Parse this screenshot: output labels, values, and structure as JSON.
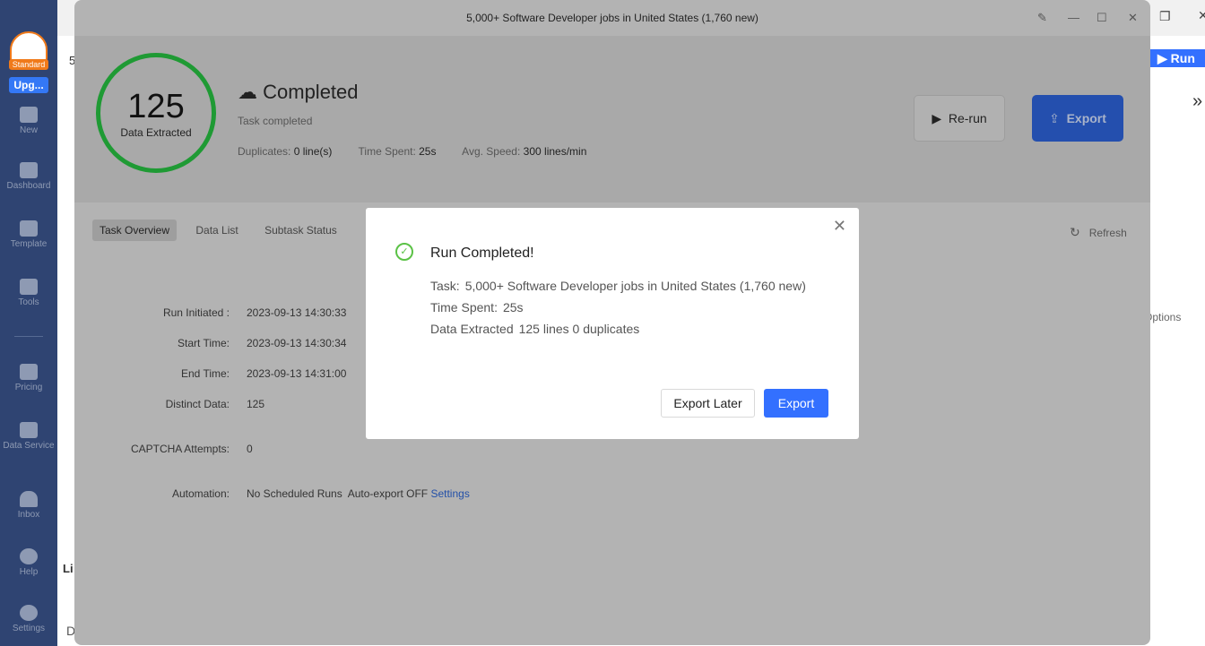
{
  "sidebar": {
    "plan_badge": "Standard",
    "upgrade": "Upg...",
    "items": [
      {
        "label": "New",
        "icon": "plus-icon"
      },
      {
        "label": "Dashboard",
        "icon": "dashboard-icon"
      },
      {
        "label": "Template",
        "icon": "template-icon"
      },
      {
        "label": "Tools",
        "icon": "toolbox-icon"
      },
      {
        "label": "Pricing",
        "icon": "crown-icon"
      },
      {
        "label": "Data Service",
        "icon": "diamond-check-icon"
      },
      {
        "label": "Inbox",
        "icon": "bell-icon"
      },
      {
        "label": "Help",
        "icon": "help-icon"
      },
      {
        "label": "Settings",
        "icon": "gear-icon"
      }
    ]
  },
  "background": {
    "frag_5": "5",
    "run": "Run",
    "frag_options": "Options",
    "frag_li": "Li",
    "frag_d": "D",
    "expand": "»"
  },
  "window": {
    "title": "5,000+ Software Developer jobs in United States (1,760 new)",
    "data_count": "125",
    "data_label": "Data Extracted",
    "status": "Completed",
    "status_sub": "Task completed",
    "duplicates_label": "Duplicates:",
    "duplicates": "0 line(s)",
    "time_label": "Time Spent:",
    "time": "25s",
    "speed_label": "Avg. Speed:",
    "speed": "300 lines/min",
    "rerun": "Re-run",
    "export": "Export",
    "tabs": [
      "Task Overview",
      "Data List",
      "Subtask Status"
    ],
    "refresh": "Refresh",
    "overview": [
      {
        "k": "Run Initiated :",
        "v": "2023-09-13 14:30:33"
      },
      {
        "k": "Start Time:",
        "v": "2023-09-13 14:30:34"
      },
      {
        "k": "End Time:",
        "v": "2023-09-13 14:31:00"
      },
      {
        "k": "Distinct Data:",
        "v": "125"
      },
      {
        "k": "CAPTCHA Attempts:",
        "v": "0"
      }
    ],
    "automation_label": "Automation:",
    "automation_value": "No Scheduled Runs  Auto-export OFF",
    "automation_link": "Settings"
  },
  "modal": {
    "title": "Run Completed!",
    "task_label": "Task:",
    "task": "5,000+ Software Developer jobs in United States (1,760 new)",
    "time_label": "Time Spent:",
    "time": "25s",
    "data_label": "Data Extracted",
    "data": "125 lines 0 duplicates",
    "later": "Export Later",
    "export": "Export"
  },
  "colors": {
    "accent": "#3370ff",
    "success": "#5bc246",
    "ring": "#1f9a34",
    "sidebar": "#2f4472"
  }
}
